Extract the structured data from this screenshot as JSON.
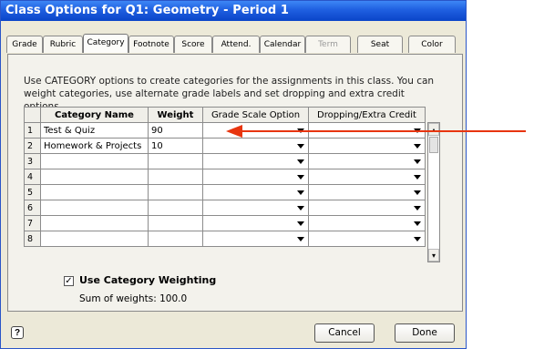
{
  "window": {
    "title": "Class Options for Q1: Geometry - Period 1"
  },
  "tabs": [
    {
      "label": "Grade"
    },
    {
      "label": "Rubric"
    },
    {
      "label": "Category"
    },
    {
      "label": "Footnote"
    },
    {
      "label": "Score"
    },
    {
      "label": "Attend."
    },
    {
      "label": "Calendar"
    },
    {
      "label": "Term"
    },
    {
      "label": "Seat"
    },
    {
      "label": "Color"
    }
  ],
  "description": "Use CATEGORY options to create categories for the assignments in this class. You can weight categories, use alternate grade labels and set dropping and extra credit options.",
  "table": {
    "headers": [
      "",
      "Category Name",
      "Weight",
      "Grade Scale Option",
      "Dropping/Extra Credit"
    ],
    "rows": [
      {
        "num": "1",
        "name": "Test & Quiz",
        "weight": "90"
      },
      {
        "num": "2",
        "name": "Homework & Projects",
        "weight": "10"
      },
      {
        "num": "3",
        "name": "",
        "weight": ""
      },
      {
        "num": "4",
        "name": "",
        "weight": ""
      },
      {
        "num": "5",
        "name": "",
        "weight": ""
      },
      {
        "num": "6",
        "name": "",
        "weight": ""
      },
      {
        "num": "7",
        "name": "",
        "weight": ""
      },
      {
        "num": "8",
        "name": "",
        "weight": ""
      }
    ]
  },
  "weighting": {
    "label": "Use Category Weighting",
    "checked": true,
    "check_glyph": "✓"
  },
  "sum": "Sum of weights: 100.0",
  "buttons": {
    "help": "?",
    "cancel": "Cancel",
    "done": "Done"
  },
  "colors": {
    "title_bar": "#1f5fe0",
    "callout_arrow": "#e8350f"
  }
}
